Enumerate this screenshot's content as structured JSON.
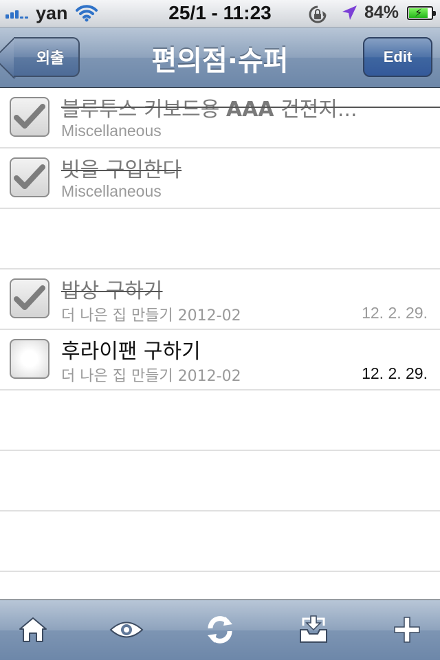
{
  "status_bar": {
    "carrier": "yan",
    "time": "25/1 - 11:23",
    "battery_percent_text": "84%",
    "battery_level": 0.84,
    "icons": [
      "signal-icon",
      "wifi-icon",
      "rotation-lock-icon",
      "location-arrow-icon",
      "battery-charging-icon"
    ]
  },
  "nav": {
    "back_label": "외출",
    "title": "편의점·슈퍼",
    "edit_label": "Edit"
  },
  "items": [
    {
      "title_prefix": "블루투스 키보드용 ",
      "title_bold": "AAA",
      "title_suffix": " 건전지...",
      "subtitle": "Miscellaneous",
      "date": "",
      "checked": true
    },
    {
      "title": "빗을 구입한다",
      "subtitle": "Miscellaneous",
      "date": "",
      "checked": true
    },
    {
      "title": "밥상 구하기",
      "subtitle": "더 나은 집 만들기 2012-02",
      "date": "12. 2. 29.",
      "checked": true
    },
    {
      "title": "후라이팬 구하기",
      "subtitle": "더 나은 집 만들기 2012-02",
      "date": "12. 2. 29.",
      "checked": false
    }
  ],
  "toolbar": {
    "buttons": [
      "home-icon",
      "eye-icon",
      "sync-icon",
      "inbox-download-icon",
      "plus-icon"
    ]
  },
  "colors": {
    "nav_bar": "#7d95b3",
    "edit_button": "#3e66a0",
    "checked_text": "#7a7a7a",
    "active_text": "#111111"
  }
}
